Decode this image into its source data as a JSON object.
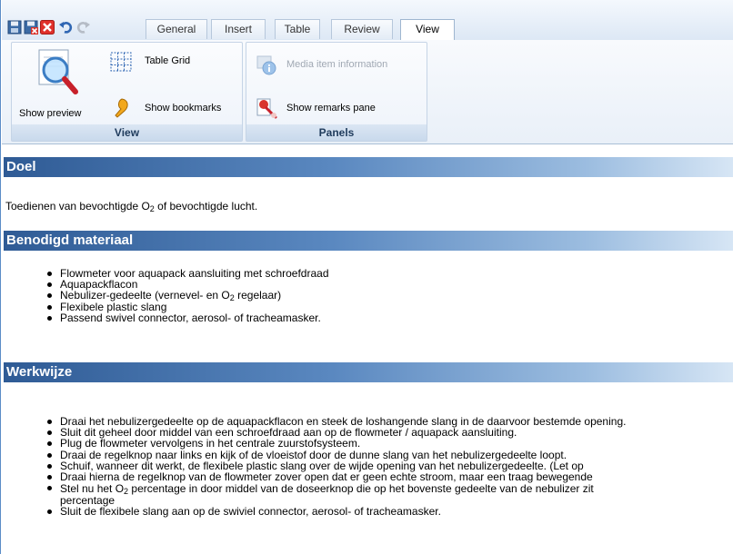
{
  "tabs": [
    "General",
    "Insert",
    "Table",
    "Review",
    "View"
  ],
  "active_tab": "View",
  "ribbon": {
    "view_group": {
      "title": "View",
      "show_preview": "Show preview",
      "table_grid": "Table Grid",
      "show_bookmarks": "Show bookmarks"
    },
    "panels_group": {
      "title": "Panels",
      "media_item_information": "Media item information",
      "show_remarks_pane": "Show remarks pane"
    }
  },
  "document": {
    "sections": [
      {
        "heading": "Doel",
        "paragraph": {
          "before": "Toedienen van bevochtigde O",
          "sub": "2",
          "after": " of bevochtigde lucht."
        }
      },
      {
        "heading": "Benodigd materiaal",
        "items": [
          "Flowmeter voor aquapack aansluiting met schroefdraad",
          "Aquapackflacon",
          {
            "before": "Nebulizer-gedeelte (vernevel- en O",
            "sub": "2",
            "after": " regelaar)"
          },
          "Flexibele plastic slang",
          "Passend swivel connector, aerosol- of tracheamasker."
        ]
      },
      {
        "heading": "Werkwijze",
        "items": [
          "Draai het nebulizergedeelte op de aquapackflacon en steek de loshangende slang in de daarvoor bestemde opening.",
          "Sluit dit geheel door middel van een schroefdraad aan op de flowmeter / aquapack aansluiting.",
          "Plug de flowmeter vervolgens in het centrale zuurstofsysteem.",
          "Draai de regelknop naar links en kijk of de vloeistof door de dunne slang van het nebulizergedeelte loopt.",
          "Schuif, wanneer dit werkt, de flexibele plastic slang over de wijde opening van het nebulizergedeelte. (Let op",
          "Draai hierna de regelknop van de flowmeter zover open dat er geen echte stroom, maar een traag bewegende",
          {
            "before": "Stel nu het O",
            "sub": "2",
            "after": " percentage in door middel van de doseerknop die op het bovenste gedeelte van de nebulizer zit"
          },
          "percentage",
          "Sluit de flexibele slang aan op de swiviel connector, aerosol- of tracheamasker."
        ]
      }
    ]
  },
  "colors": {
    "heading_bar_dark": "#2f5b95",
    "heading_bar_light": "#d7e6f5",
    "ribbon_bg": "#e9f0f8",
    "group_title_text": "#1f3b5c"
  }
}
